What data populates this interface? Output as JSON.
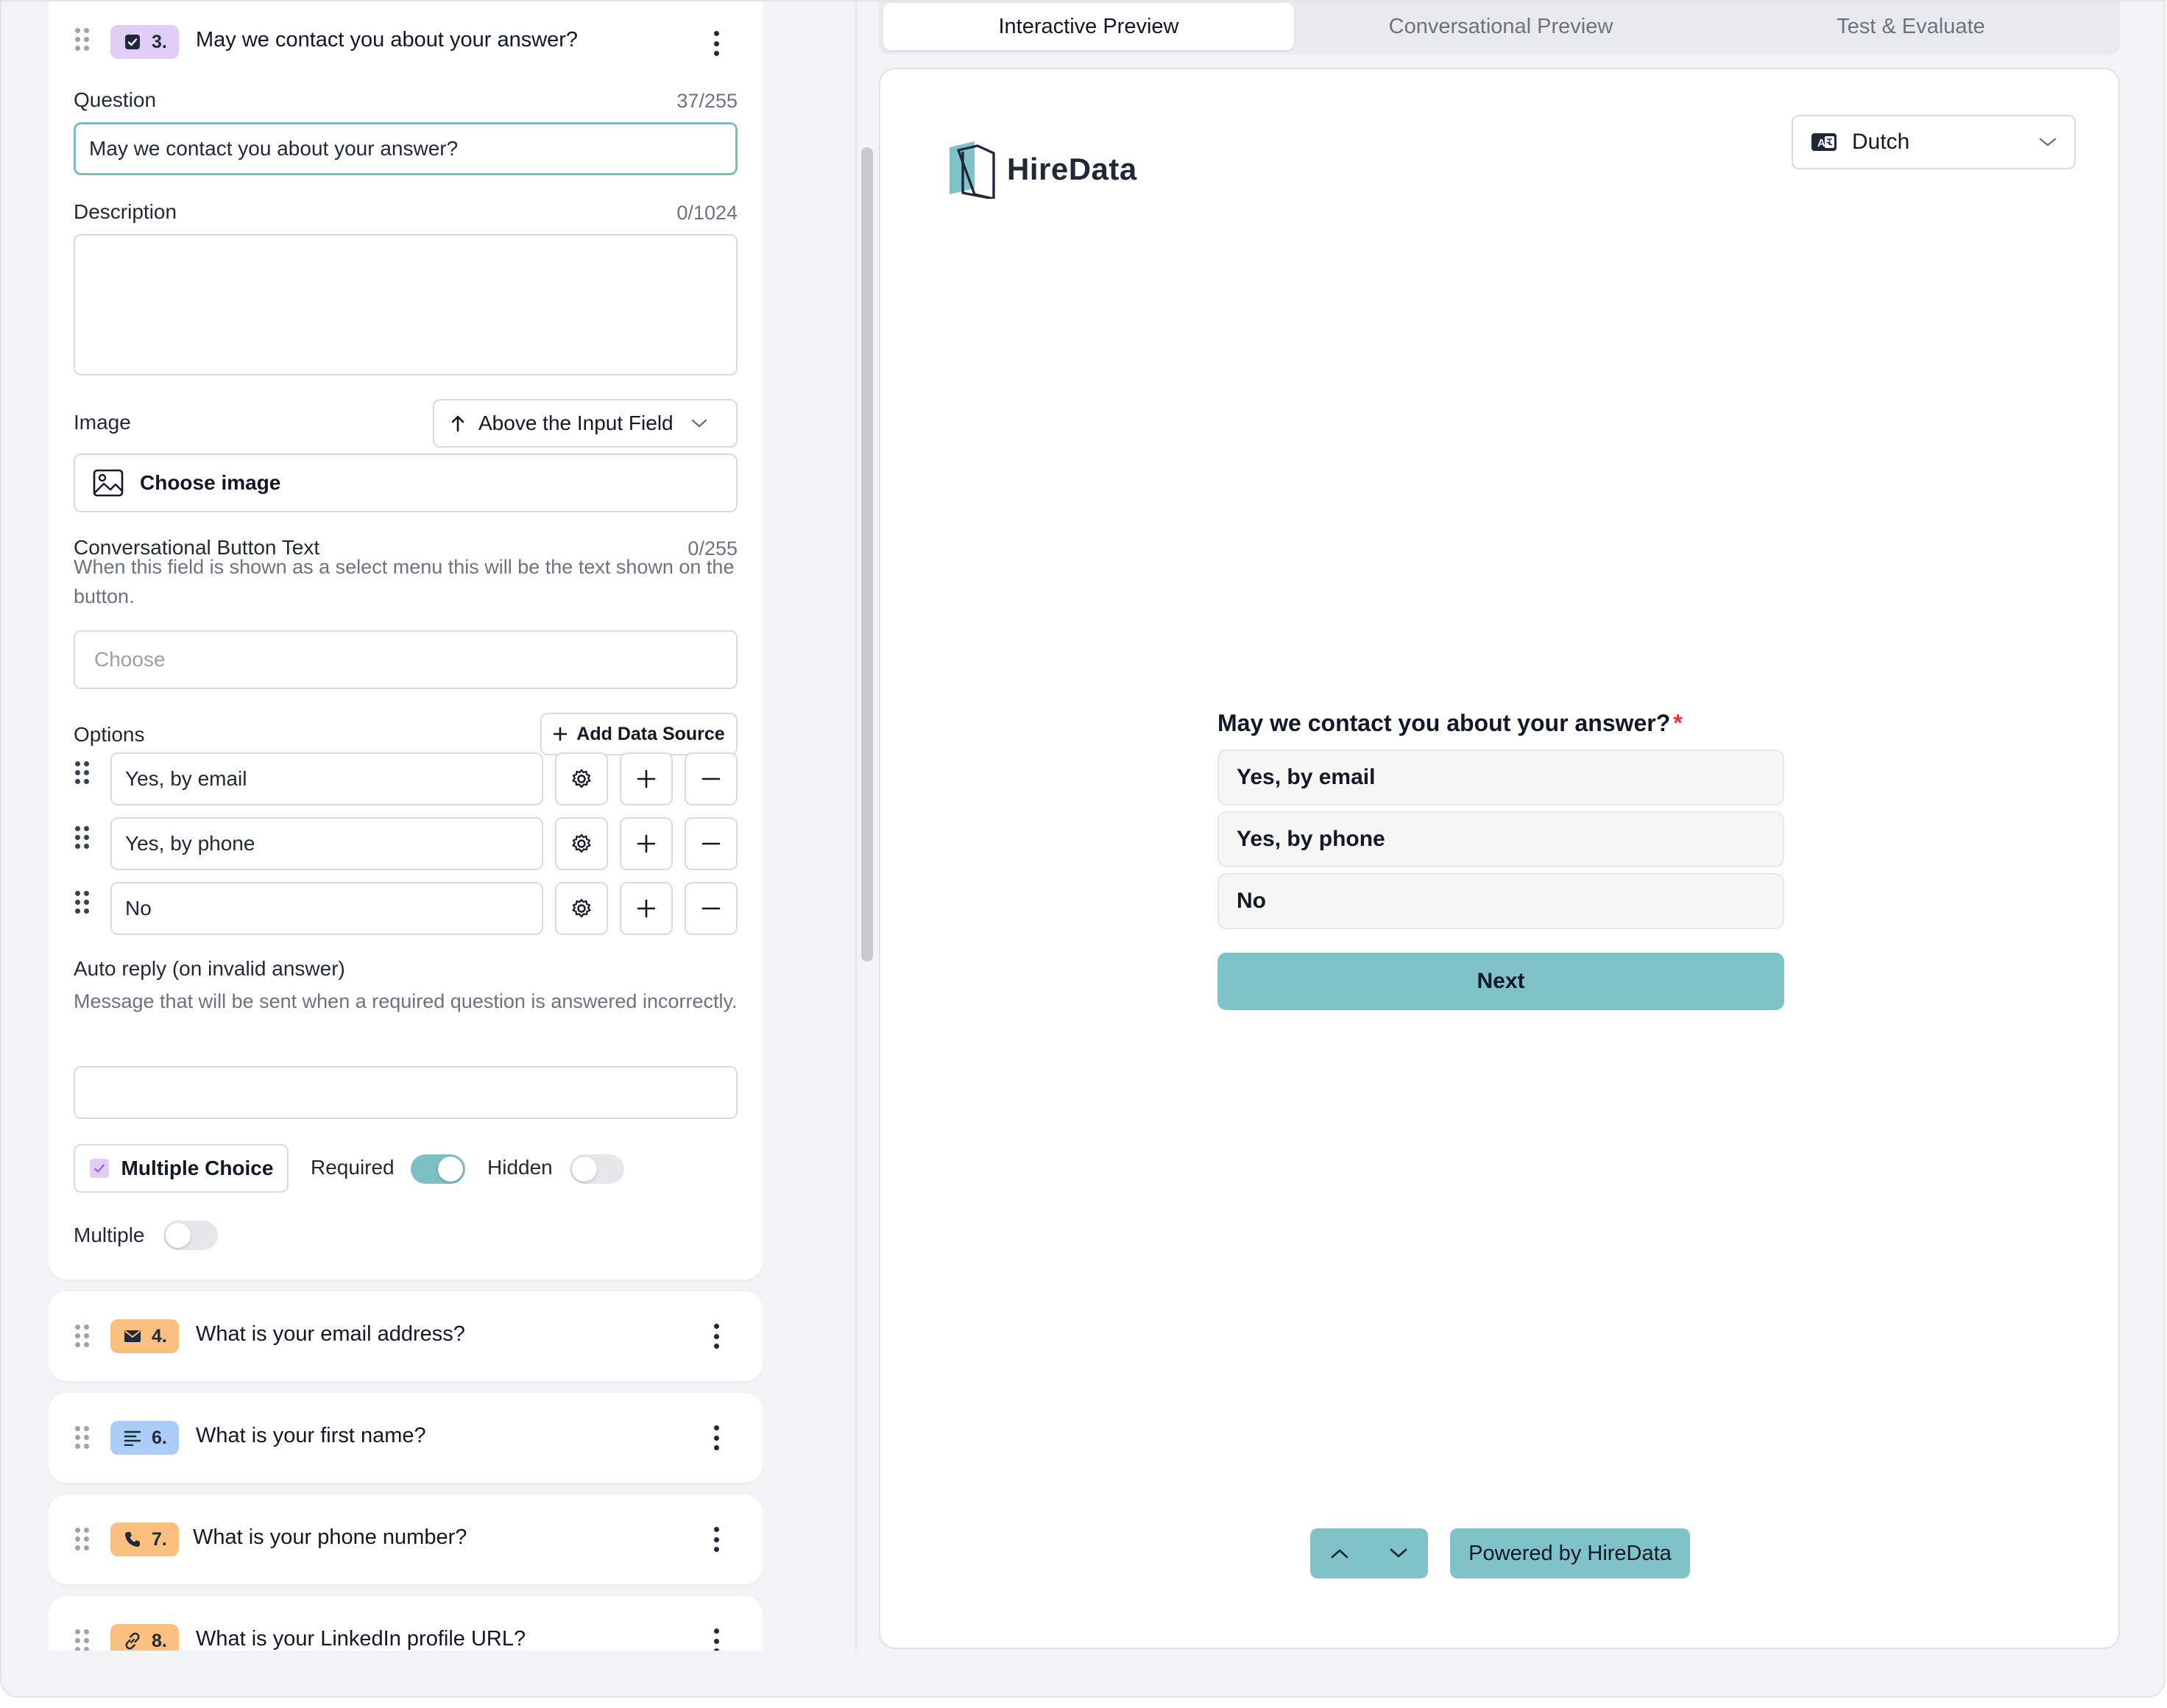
{
  "editor": {
    "open_question": {
      "number": "3.",
      "title": "May we contact you about your answer?",
      "badge_color": "#e2cdf6",
      "question_label": "Question",
      "question_counter": "37/255",
      "question_value": "May we contact you about your answer?",
      "description_label": "Description",
      "description_counter": "0/1024",
      "description_value": "",
      "image_label": "Image",
      "image_position": "Above the Input Field",
      "choose_image": "Choose image",
      "conv_button_label": "Conversational Button Text",
      "conv_button_counter": "0/255",
      "conv_button_help": "When this field is shown as a select menu this will be the text shown on the button.",
      "conv_button_placeholder": "Choose",
      "options_label": "Options",
      "add_data_source": "Add Data Source",
      "options": [
        "Yes, by email",
        "Yes, by phone",
        "No"
      ],
      "auto_reply_label": "Auto reply (on invalid answer)",
      "auto_reply_help": "Message that will be sent when a required question is answered incorrectly.",
      "auto_reply_value": "",
      "type_label": "Multiple Choice",
      "required_label": "Required",
      "required_on": true,
      "hidden_label": "Hidden",
      "hidden_on": false,
      "multiple_label": "Multiple",
      "multiple_on": false
    },
    "collapsed_questions": [
      {
        "number": "4.",
        "title": "What is your email address?",
        "icon": "envelope-icon",
        "badge_color": "#fbc07f"
      },
      {
        "number": "6.",
        "title": "What is your first name?",
        "icon": "text-lines-icon",
        "badge_color": "#a9cdf7"
      },
      {
        "number": "7.",
        "title": "What is your phone number?",
        "icon": "phone-icon",
        "badge_color": "#fbc07f"
      },
      {
        "number": "8.",
        "title": "What is your LinkedIn profile URL?",
        "icon": "link-icon",
        "badge_color": "#fbc07f"
      }
    ]
  },
  "preview": {
    "tabs": [
      "Interactive Preview",
      "Conversational Preview",
      "Test & Evaluate"
    ],
    "active_tab": "Interactive Preview",
    "brand": "HireData",
    "language": "Dutch",
    "question": "May we contact you about your answer?",
    "required_mark": "*",
    "options": [
      "Yes, by email",
      "Yes, by phone",
      "No"
    ],
    "next_label": "Next",
    "powered_by": "Powered by HireData",
    "accent_color": "#7fc3c9"
  }
}
